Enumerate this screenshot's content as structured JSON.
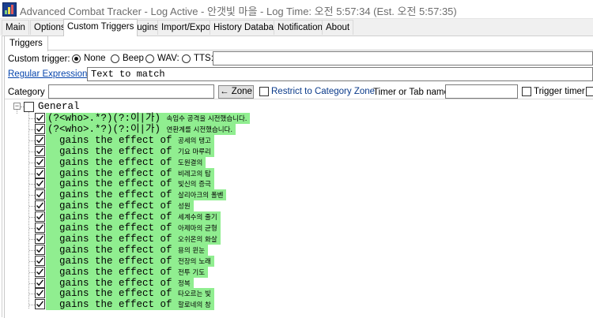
{
  "window": {
    "title": "Advanced Combat Tracker - Log Active - 안갯빛 마을 - Log Time: 오전 5:57:34 (Est. 오전 5:57:35)"
  },
  "tabs": [
    "Main",
    "Options",
    "Custom Triggers",
    "Plugins",
    "Import/Export",
    "History Database",
    "Notifications",
    "About"
  ],
  "active_tab": "Custom Triggers",
  "subtab": "Triggers",
  "trigger_form": {
    "custom_trigger_label": "Custom trigger:",
    "sound_options": [
      "None",
      "Beep",
      "WAV:",
      "TTS:"
    ],
    "selected_sound": "None",
    "regex_label": "Regular Expression:",
    "regex_value": "Text to match",
    "category_label": "Category",
    "category_value": "",
    "zone_button": "← Zone",
    "restrict_label": "Restrict to Category Zone",
    "timer_label": "Timer or Tab name",
    "timer_value": "",
    "trigger_timer_label": "Trigger timer"
  },
  "tree": {
    "group": "General",
    "entries": [
      {
        "prefix": "(?<who>.*?)(?:이|가) ",
        "kr": "속임수 공격을 시전했습니다."
      },
      {
        "prefix": "(?<who>.*?)(?:이|가) ",
        "kr": "연환계를 시전했습니다."
      },
      {
        "prefix": "  gains the effect of ",
        "kr": "공세의 탱고"
      },
      {
        "prefix": "  gains the effect of ",
        "kr": "기요 마루리"
      },
      {
        "prefix": "  gains the effect of ",
        "kr": "도원결의"
      },
      {
        "prefix": "  gains the effect of ",
        "kr": "비레고의 탑"
      },
      {
        "prefix": "  gains the effect of ",
        "kr": "빛신의 증극"
      },
      {
        "prefix": "  gains the effect of ",
        "kr": "살리아크의 폴벤"
      },
      {
        "prefix": "  gains the effect of ",
        "kr": "성원"
      },
      {
        "prefix": "  gains the effect of ",
        "kr": "세계수의 줄기"
      },
      {
        "prefix": "  gains the effect of ",
        "kr": "아제마의 균형"
      },
      {
        "prefix": "  gains the effect of ",
        "kr": "오쉬온의 화살"
      },
      {
        "prefix": "  gains the effect of ",
        "kr": "용의 윈눈"
      },
      {
        "prefix": "  gains the effect of ",
        "kr": "전장의 노래"
      },
      {
        "prefix": "  gains the effect of ",
        "kr": "전투 기도"
      },
      {
        "prefix": "  gains the effect of ",
        "kr": "정복"
      },
      {
        "prefix": "  gains the effect of ",
        "kr": "타오르는 빛"
      },
      {
        "prefix": "  gains the effect of ",
        "kr": "할로네의 창"
      }
    ]
  },
  "colors": {
    "entry_highlight": "#90ee90",
    "link": "#0645ad"
  }
}
